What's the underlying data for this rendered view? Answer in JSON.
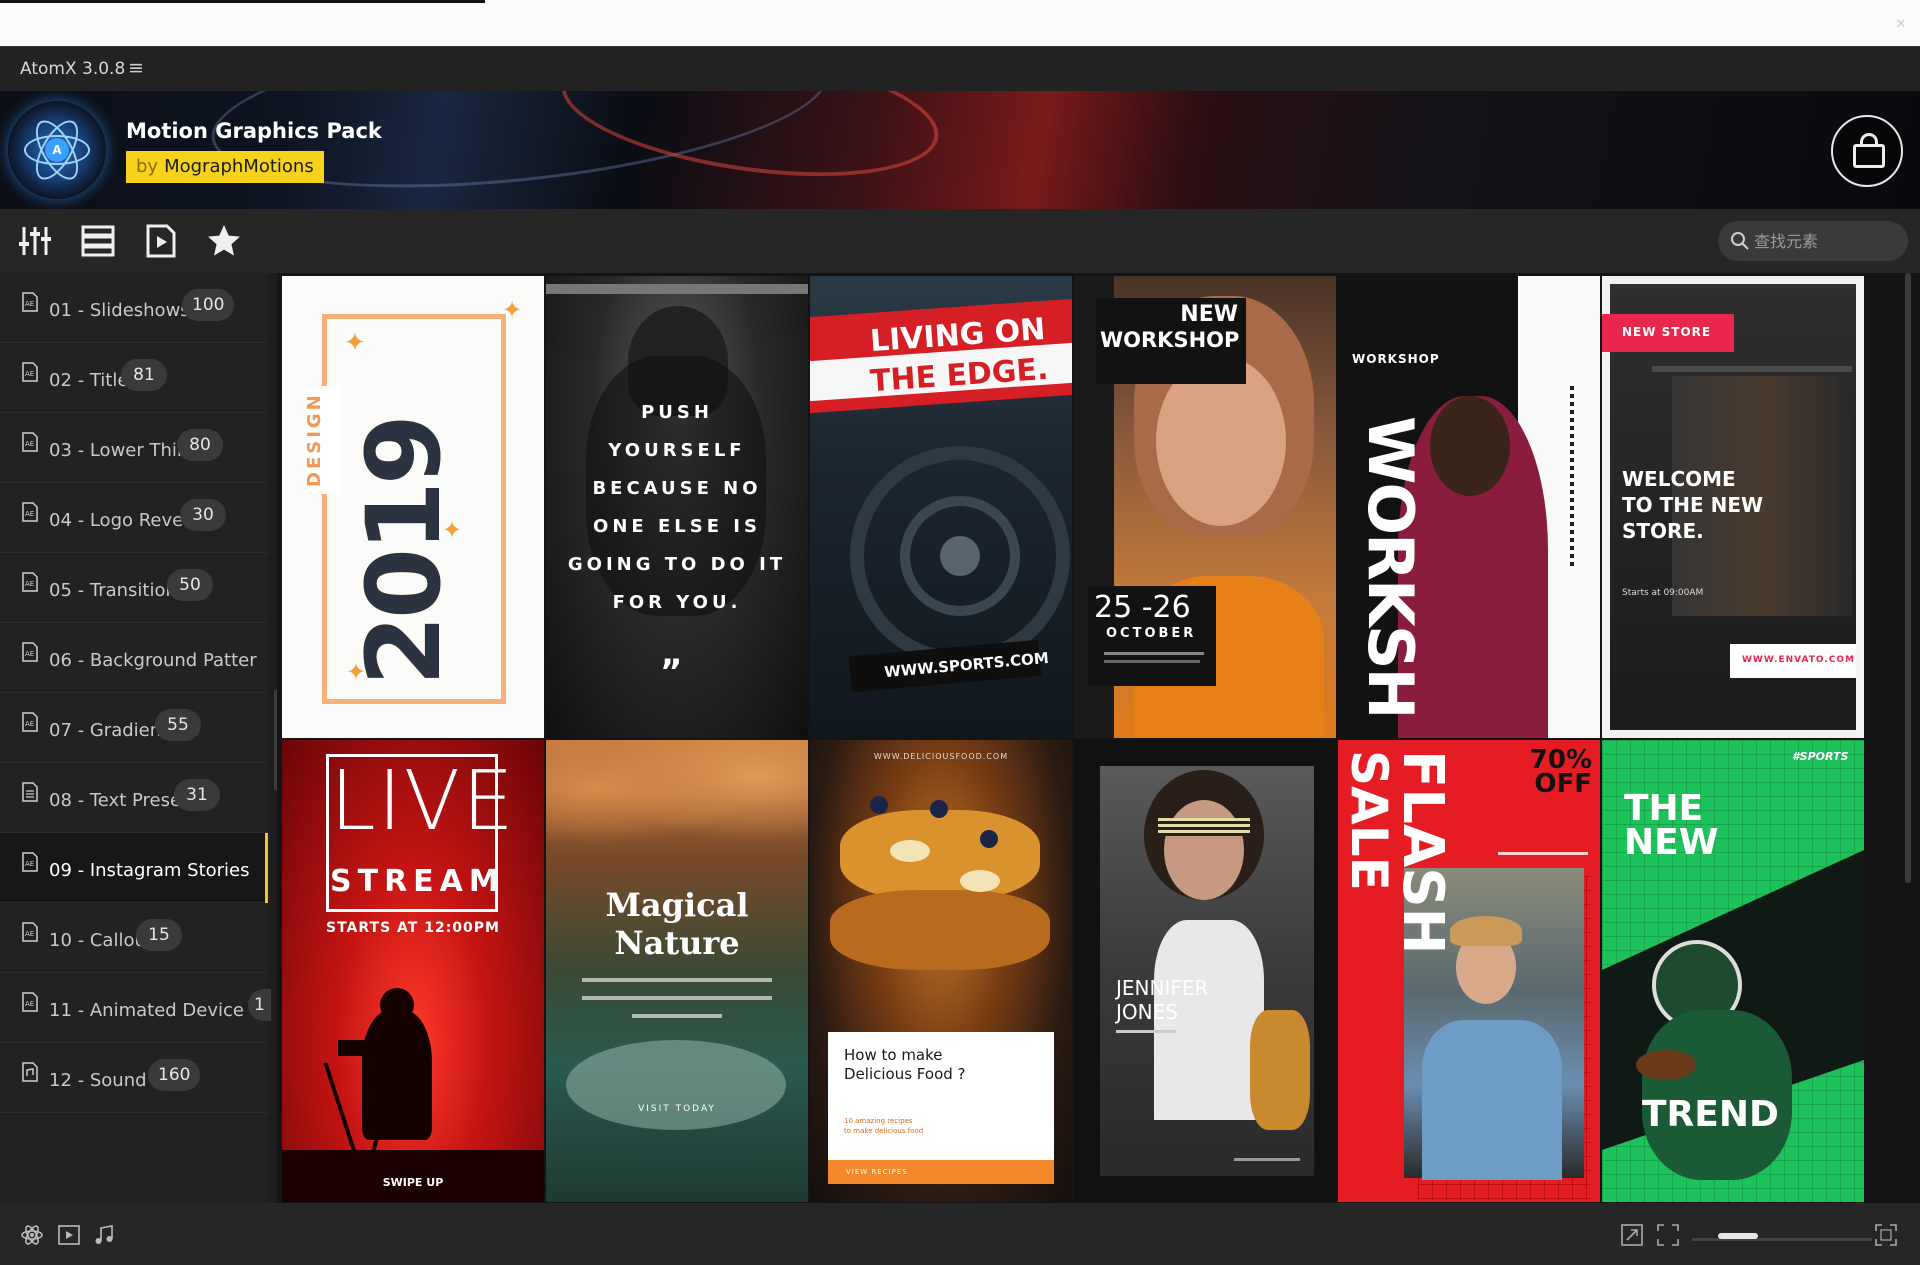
{
  "app": {
    "title": "AtomX 3.0.8",
    "menu_icon": "hamburger-menu-icon"
  },
  "banner": {
    "pack_title": "Motion Graphics Pack",
    "by_prefix": "by",
    "author": "MographMotions",
    "logo_letter": "A",
    "accent": "#f6d21a"
  },
  "toolbar": {
    "icons": [
      "sliders-icon",
      "list-view-icon",
      "play-icon",
      "star-icon"
    ],
    "search_placeholder": "查找元素"
  },
  "sidebar": {
    "items": [
      {
        "label": "01 - Slideshows",
        "count": "100",
        "icon": "ae-file-icon"
      },
      {
        "label": "02 - Titles",
        "count": "81",
        "icon": "ae-file-icon"
      },
      {
        "label": "03 - Lower Thirds",
        "count": "80",
        "icon": "ae-file-icon"
      },
      {
        "label": "04 - Logo Reveals",
        "count": "30",
        "icon": "ae-file-icon"
      },
      {
        "label": "05 - Transitions",
        "count": "50",
        "icon": "ae-file-icon"
      },
      {
        "label": "06 - Background Patter",
        "count": "",
        "icon": "ae-file-icon"
      },
      {
        "label": "07 - Gradients",
        "count": "55",
        "icon": "ae-file-icon"
      },
      {
        "label": "08 - Text Presets",
        "count": "31",
        "icon": "text-file-icon"
      },
      {
        "label": "09 - Instagram Stories",
        "count": "",
        "icon": "ae-file-icon",
        "active": true
      },
      {
        "label": "10 - Callouts",
        "count": "15",
        "icon": "ae-file-icon"
      },
      {
        "label": "11 - Animated Device",
        "count": "1",
        "icon": "ae-file-icon"
      },
      {
        "label": "12 - Sound Fx",
        "count": "160",
        "icon": "sound-file-icon"
      }
    ]
  },
  "cards": [
    {
      "lines": [
        "DESIGN",
        "2019"
      ]
    },
    {
      "lines": [
        "PUSH",
        "YOURSELF",
        "BECAUSE NO",
        "ONE ELSE IS",
        "GOING TO DO IT",
        "FOR YOU."
      ]
    },
    {
      "lines": [
        "LIVING ON",
        "THE EDGE.",
        "WWW.SPORTS.COM"
      ]
    },
    {
      "lines": [
        "NEW",
        "WORKSHOP",
        "25 -26",
        "OCTOBER"
      ]
    },
    {
      "lines": [
        "WORKSHOP",
        "WORKSH"
      ]
    },
    {
      "lines": [
        "NEW STORE",
        "WELCOME",
        "TO THE NEW",
        "STORE.",
        "Starts at 09:00AM",
        "WWW.ENVATO.COM"
      ]
    },
    {
      "lines": [
        "LIVE",
        "STREAM",
        "STARTS AT 12:00PM",
        "SWIPE UP"
      ]
    },
    {
      "lines": [
        "Magical",
        "Nature",
        "VISIT TODAY"
      ]
    },
    {
      "lines": [
        "WWW.DELICIOUSFOOD.COM",
        "How to make",
        "Delicious Food ?",
        "10 amazing recipes",
        "to make delicious food",
        "VIEW RECIPES"
      ]
    },
    {
      "lines": [
        "JENNIFER",
        "JONES"
      ]
    },
    {
      "lines": [
        "FLASH",
        "SALE",
        "70%",
        "OFF"
      ]
    },
    {
      "lines": [
        "#SPORTS",
        "THE",
        "NEW",
        "TREND"
      ]
    }
  ],
  "bottombar": {
    "left_icons": [
      "atom-icon",
      "video-file-icon",
      "music-note-icon"
    ],
    "right_icons": [
      "expand-icon",
      "fit-screen-icon",
      "fullscreen-icon"
    ],
    "zoom_level": 0.2
  }
}
